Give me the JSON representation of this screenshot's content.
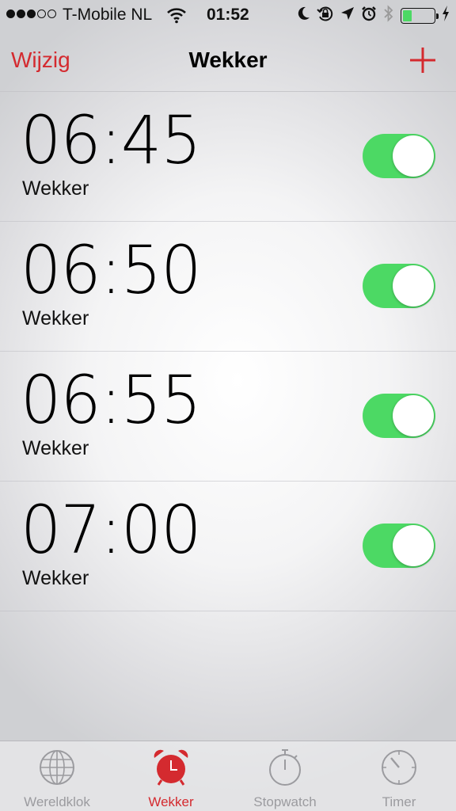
{
  "status_bar": {
    "carrier": "T-Mobile NL",
    "time": "01:52",
    "signal_bars_filled": 3,
    "signal_bars_total": 5,
    "battery_level": 0.28,
    "icons": [
      "wifi-icon",
      "moon-icon",
      "rotation-lock-icon",
      "location-icon",
      "alarm-icon",
      "bluetooth-icon",
      "battery-icon",
      "charging-icon"
    ]
  },
  "nav": {
    "edit_label": "Wijzig",
    "title": "Wekker",
    "add_icon": "plus-icon"
  },
  "alarms": [
    {
      "time": "06:45",
      "label": "Wekker",
      "enabled": true
    },
    {
      "time": "06:50",
      "label": "Wekker",
      "enabled": true
    },
    {
      "time": "06:55",
      "label": "Wekker",
      "enabled": true
    },
    {
      "time": "07:00",
      "label": "Wekker",
      "enabled": true
    }
  ],
  "tabs": [
    {
      "label": "Wereldklok",
      "icon": "globe-icon",
      "active": false
    },
    {
      "label": "Wekker",
      "icon": "alarm-clock-icon",
      "active": true
    },
    {
      "label": "Stopwatch",
      "icon": "stopwatch-icon",
      "active": false
    },
    {
      "label": "Timer",
      "icon": "timer-icon",
      "active": false
    }
  ],
  "colors": {
    "accent": "#d42a2f",
    "toggle_on": "#4cd964",
    "tab_inactive": "#9b9b9f"
  }
}
